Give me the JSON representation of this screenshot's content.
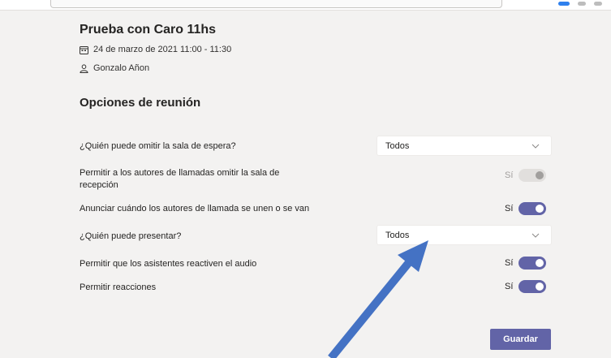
{
  "meeting": {
    "title": "Prueba con Caro 11hs",
    "date_time": "24 de marzo de 2021 11:00 - 11:30",
    "organizer": "Gonzalo Añon"
  },
  "section_title": "Opciones de reunión",
  "options": {
    "lobby_bypass": {
      "label": "¿Quién puede omitir la sala de espera?",
      "value": "Todos"
    },
    "callers_bypass": {
      "label": "Permitir a los autores de llamadas omitir la sala de recepción",
      "state": "Sí",
      "enabled": false
    },
    "announce_callers": {
      "label": "Anunciar cuándo los autores de llamada se unen o se van",
      "state": "Sí",
      "on": true
    },
    "who_presents": {
      "label": "¿Quién puede presentar?",
      "value": "Todos"
    },
    "allow_unmute": {
      "label": "Permitir que los asistentes reactiven el audio",
      "state": "Sí",
      "on": true
    },
    "allow_reactions": {
      "label": "Permitir reacciones",
      "state": "Sí",
      "on": true
    }
  },
  "save_label": "Guardar",
  "colors": {
    "accent": "#6264a7",
    "arrow": "#4472c4",
    "background": "#f3f2f1"
  },
  "icons": {
    "calendar": "calendar-icon",
    "person": "person-icon",
    "chevron": "chevron-down-icon"
  }
}
